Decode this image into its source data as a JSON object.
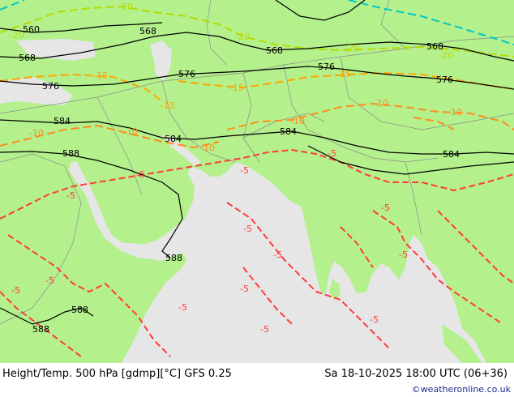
{
  "footer": {
    "title": "Height/Temp. 500 hPa [gdmp][°C] GFS 0.25",
    "datetime": "Sa 18-10-2025 18:00 UTC (06+36)",
    "credit": "©weatheronline.co.uk"
  },
  "colors": {
    "land": "#b4f08c",
    "sea": "#e6e6e6",
    "height_contour": "#000000",
    "temp_minus5": "#ff3c3c",
    "temp_minus10": "#ff8c1e",
    "temp_minus15": "#ffa500",
    "temp_minus20": "#b4dc00",
    "temp_minus25": "#00c8c8",
    "border": "#8c8c8c"
  },
  "height_labels": [
    "560",
    "568",
    "568",
    "568",
    "568",
    "576",
    "576",
    "576",
    "576",
    "584",
    "584",
    "584",
    "584",
    "588",
    "588",
    "588",
    "588"
  ],
  "temp_labels": [
    "-20",
    "-20",
    "-20",
    "-20",
    "-20",
    "-15",
    "-15",
    "-15",
    "-15",
    "-10",
    "-10",
    "-10",
    "-10",
    "-10",
    "-10",
    "-5",
    "-5",
    "-5",
    "-5",
    "-5",
    "-5",
    "-5",
    "-5",
    "-5",
    "-5",
    "-5",
    "-5",
    "-5",
    "-5"
  ]
}
